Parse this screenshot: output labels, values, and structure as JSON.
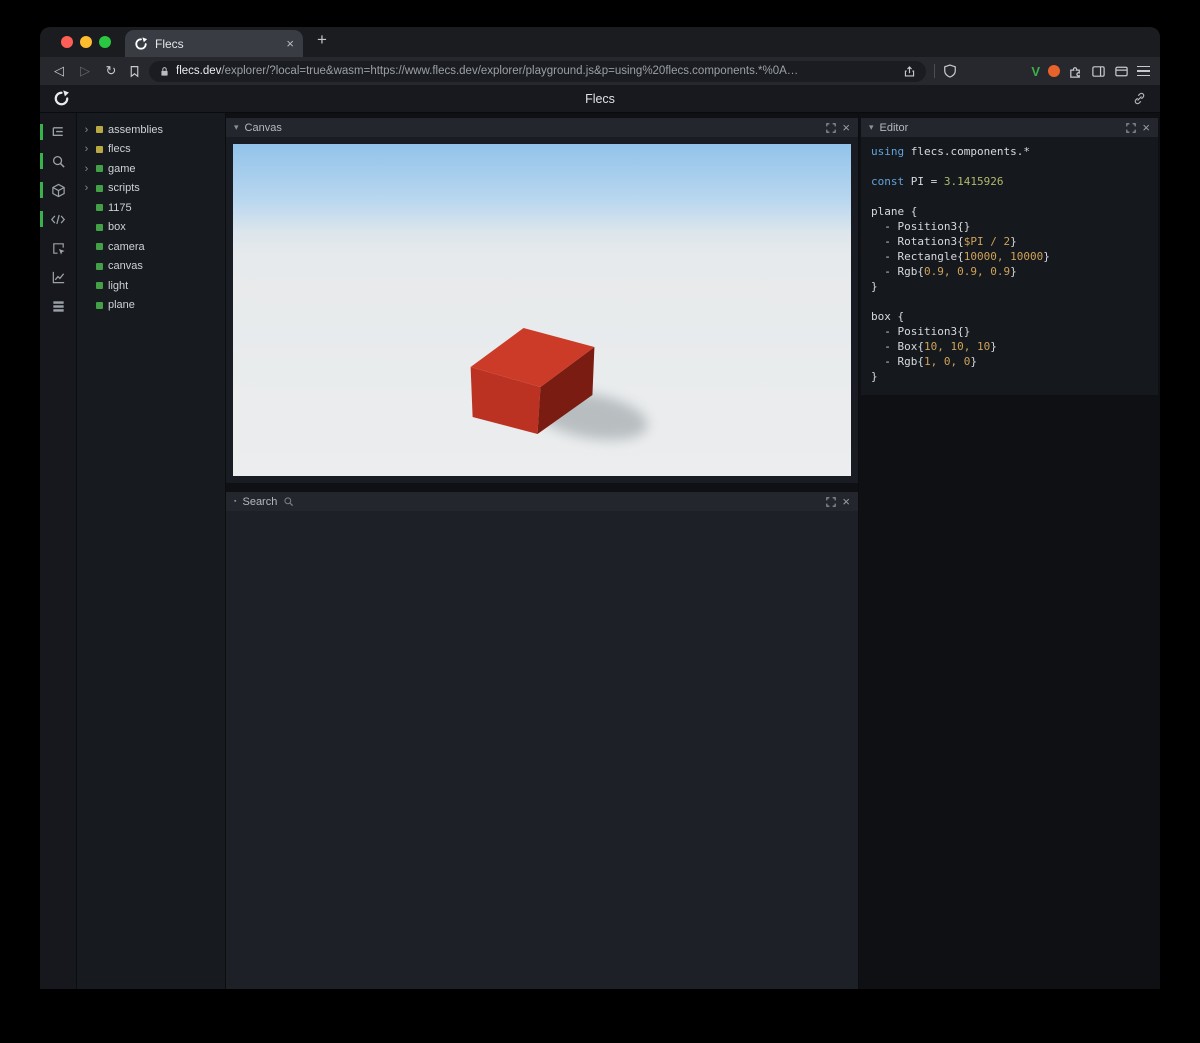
{
  "browser": {
    "tab_title": "Flecs",
    "new_tab_icon": "+",
    "back_icon": "◁",
    "forward_icon": "▷",
    "reload_icon": "↻",
    "close_tab_icon": "×",
    "url_domain": "flecs.dev",
    "url_path": "/explorer/?local=true&wasm=https://www.flecs.dev/explorer/playground.js&p=using%20flecs.components.*%0A…",
    "extension_v_label": "V"
  },
  "app": {
    "title": "Flecs"
  },
  "activity_bar": {
    "icons": [
      "hierarchy-icon",
      "search-icon",
      "cube-icon",
      "code-icon",
      "inspect-icon",
      "chart-icon",
      "rows-icon"
    ],
    "active": [
      true,
      true,
      true,
      true,
      false,
      false,
      false
    ]
  },
  "tree": {
    "items": [
      {
        "label": "assemblies",
        "color": "#b8a944",
        "expandable": true
      },
      {
        "label": "flecs",
        "color": "#b8a944",
        "expandable": true
      },
      {
        "label": "game",
        "color": "#43a047",
        "expandable": true
      },
      {
        "label": "scripts",
        "color": "#43a047",
        "expandable": true
      },
      {
        "label": "1175",
        "color": "#43a047",
        "expandable": false
      },
      {
        "label": "box",
        "color": "#43a047",
        "expandable": false
      },
      {
        "label": "camera",
        "color": "#43a047",
        "expandable": false
      },
      {
        "label": "canvas",
        "color": "#43a047",
        "expandable": false
      },
      {
        "label": "light",
        "color": "#43a047",
        "expandable": false
      },
      {
        "label": "plane",
        "color": "#43a047",
        "expandable": false
      }
    ]
  },
  "panels": {
    "canvas": {
      "title": "Canvas",
      "chevron": "▾",
      "close": "×"
    },
    "search": {
      "title": "Search",
      "bullet": "▪",
      "close": "×"
    },
    "editor": {
      "title": "Editor",
      "chevron": "▾",
      "close": "×"
    }
  },
  "editor": {
    "lines": [
      [
        [
          "using",
          "k"
        ],
        [
          " flecs.components.*",
          "p"
        ]
      ],
      [],
      [
        [
          "const",
          "k"
        ],
        [
          " PI = ",
          "p"
        ],
        [
          "3.1415926",
          "n"
        ]
      ],
      [],
      [
        [
          "plane {",
          "p"
        ]
      ],
      [
        [
          "  - Position3{}",
          "p"
        ]
      ],
      [
        [
          "  - Rotation3{",
          "p"
        ],
        [
          "$PI / 2",
          "v"
        ],
        [
          "}",
          "p"
        ]
      ],
      [
        [
          "  - Rectangle{",
          "p"
        ],
        [
          "10000, 10000",
          "v"
        ],
        [
          "}",
          "p"
        ]
      ],
      [
        [
          "  - Rgb{",
          "p"
        ],
        [
          "0.9, 0.9, 0.9",
          "v"
        ],
        [
          "}",
          "p"
        ]
      ],
      [
        [
          "}",
          "p"
        ]
      ],
      [],
      [
        [
          "box {",
          "p"
        ]
      ],
      [
        [
          "  - Position3{}",
          "p"
        ]
      ],
      [
        [
          "  - Box{",
          "p"
        ],
        [
          "10, 10, 10",
          "v"
        ],
        [
          "}",
          "p"
        ]
      ],
      [
        [
          "  - Rgb{",
          "p"
        ],
        [
          "1, 0, 0",
          "v"
        ],
        [
          "}",
          "p"
        ]
      ],
      [
        [
          "}",
          "p"
        ]
      ]
    ]
  },
  "colors": {
    "accent_green": "#37b24d",
    "sky_top": "#92c3ea",
    "sky_mid": "#b9d7ef",
    "horizon": "#dde6ec",
    "ground": "#ebedee",
    "box_top": "#cb3b28",
    "box_front": "#bc3222",
    "box_side": "#7a1c11",
    "shadow": "#7d868b"
  }
}
